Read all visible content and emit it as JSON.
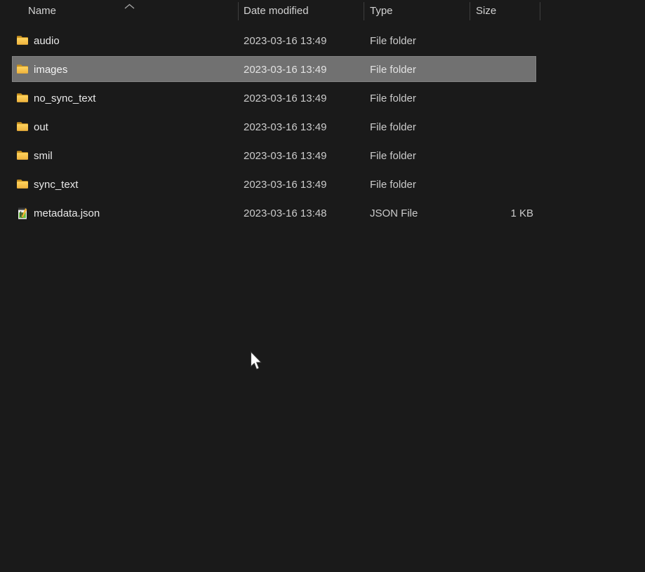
{
  "window": {
    "kind": "file-explorer-details-view",
    "background_color": "#1a1a1a"
  },
  "columns": {
    "name": "Name",
    "date_modified": "Date modified",
    "type": "Type",
    "size": "Size"
  },
  "sort": {
    "column": "Name",
    "direction": "ascending",
    "indicator_icon": "chevron-up-icon"
  },
  "files": [
    {
      "name": "audio",
      "date_modified": "2023-03-16 13:49",
      "type": "File folder",
      "size": "",
      "icon": "folder-icon",
      "selected": false
    },
    {
      "name": "images",
      "date_modified": "2023-03-16 13:49",
      "type": "File folder",
      "size": "",
      "icon": "folder-icon",
      "selected": true
    },
    {
      "name": "no_sync_text",
      "date_modified": "2023-03-16 13:49",
      "type": "File folder",
      "size": "",
      "icon": "folder-icon",
      "selected": false
    },
    {
      "name": "out",
      "date_modified": "2023-03-16 13:49",
      "type": "File folder",
      "size": "",
      "icon": "folder-icon",
      "selected": false
    },
    {
      "name": "smil",
      "date_modified": "2023-03-16 13:49",
      "type": "File folder",
      "size": "",
      "icon": "folder-icon",
      "selected": false
    },
    {
      "name": "sync_text",
      "date_modified": "2023-03-16 13:49",
      "type": "File folder",
      "size": "",
      "icon": "folder-icon",
      "selected": false
    },
    {
      "name": "metadata.json",
      "date_modified": "2023-03-16 13:48",
      "type": "JSON File",
      "size": "1 KB",
      "icon": "json-file-icon",
      "selected": false
    }
  ],
  "colors": {
    "selection_fill": "#717171",
    "selection_border": "#838383",
    "header_text": "#d2d2d2",
    "primary_text": "#e9e9e9",
    "secondary_text": "#cbcbcb",
    "folder_yellow_top": "#ffd45e",
    "folder_yellow_bottom": "#eeb23d",
    "folder_back": "#c9921f"
  },
  "cursor": {
    "visible": true,
    "style": "arrow"
  }
}
